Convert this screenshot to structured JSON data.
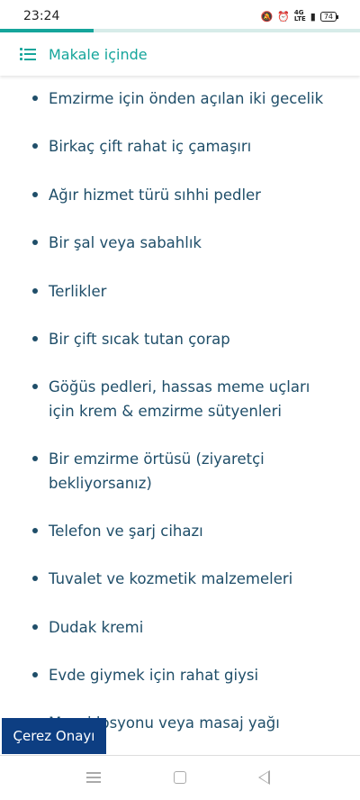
{
  "status_bar": {
    "time": "23:24",
    "network_label": "4G",
    "lte_label": "LTE",
    "battery": "74"
  },
  "reading_progress": {
    "fraction": 0.26
  },
  "toc_header": {
    "title": "Makale içinde"
  },
  "list": {
    "items": [
      "Emzirme için önden açılan iki gecelik",
      "Birkaç çift rahat iç çamaşırı",
      "Ağır hizmet türü sıhhi pedler",
      "Bir şal veya sabahlık",
      "Terlikler",
      "Bir çift sıcak tutan çorap",
      "Göğüs pedleri, hassas meme uçları için krem & emzirme sütyenleri",
      "Bir emzirme örtüsü (ziyaretçi bekliyorsanız)",
      "Telefon ve şarj cihazı",
      "Tuvalet ve kozmetik malzemeleri",
      "Dudak kremi",
      "Evde giymek için rahat giysi",
      "Masaj losyonu veya masaj yağı"
    ]
  },
  "cookie_banner": {
    "label": "Çerez Onayı"
  },
  "colors": {
    "accent": "#15a59b",
    "text": "#1f4e69",
    "cookie_bg": "#0d3e82"
  }
}
